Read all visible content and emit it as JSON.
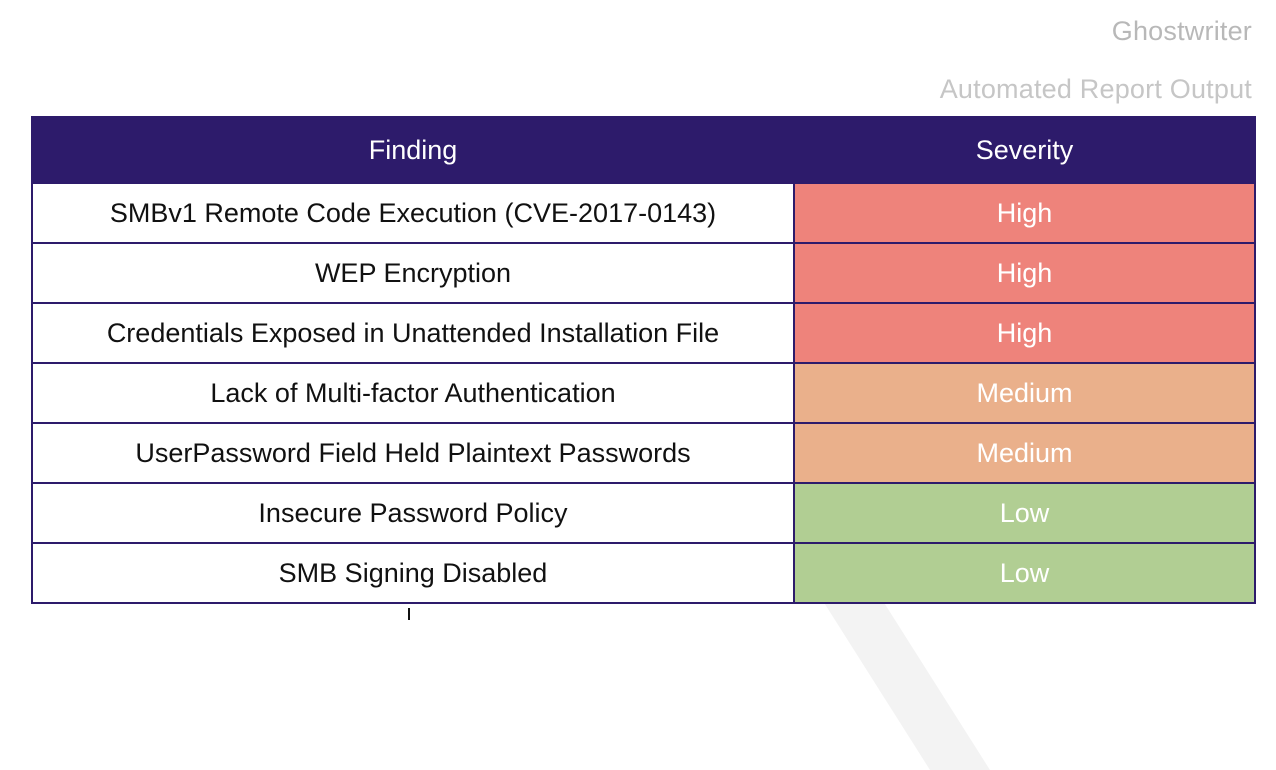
{
  "header": {
    "brand": "Ghostwriter",
    "subtitle": "Automated Report Output"
  },
  "table": {
    "columns": {
      "finding": "Finding",
      "severity": "Severity"
    },
    "rows": [
      {
        "finding": "SMBv1 Remote Code Execution (CVE-2017-0143)",
        "severity": "High"
      },
      {
        "finding": "WEP Encryption",
        "severity": "High"
      },
      {
        "finding": "Credentials Exposed in Unattended Installation File",
        "severity": "High"
      },
      {
        "finding": "Lack of Multi-factor Authentication",
        "severity": "Medium"
      },
      {
        "finding": "UserPassword Field Held Plaintext Passwords",
        "severity": "Medium"
      },
      {
        "finding": "Insecure Password Policy",
        "severity": "Low"
      },
      {
        "finding": "SMB Signing Disabled",
        "severity": "Low"
      }
    ]
  },
  "colors": {
    "header_bg": "#2d1b6b",
    "severity": {
      "High": "#ee837b",
      "Medium": "#eab08b",
      "Low": "#b1ce93"
    }
  }
}
